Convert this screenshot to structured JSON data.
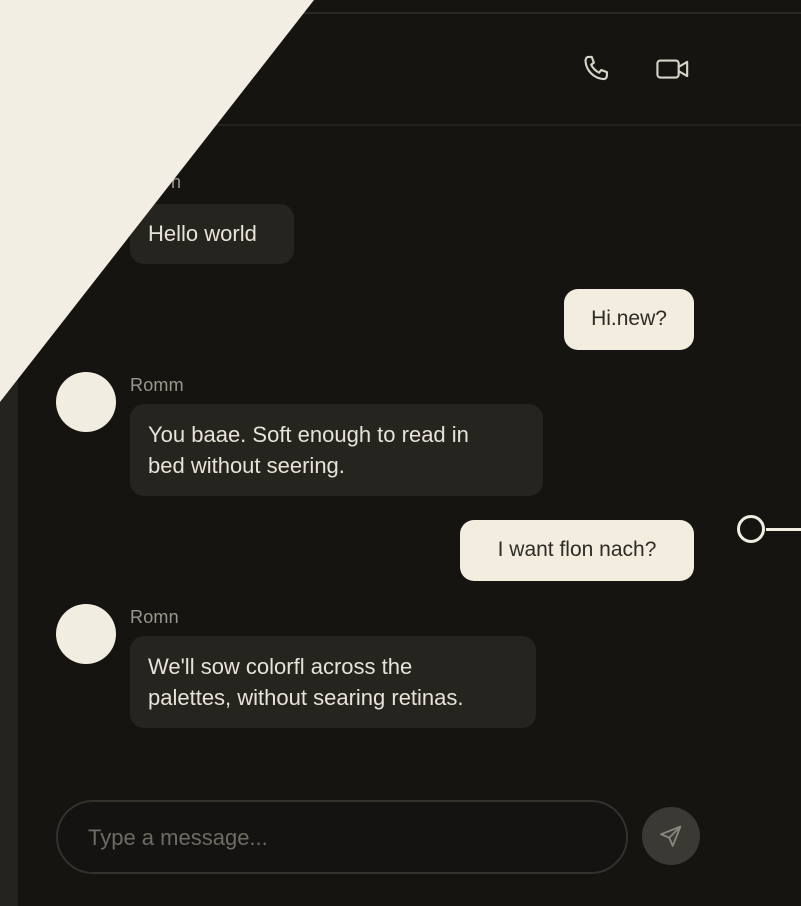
{
  "header": {
    "call_icon": "phone-icon",
    "video_icon": "video-camera-icon"
  },
  "messages": [
    {
      "direction": "incoming",
      "sender": "n",
      "text": "Hello world"
    },
    {
      "direction": "outgoing",
      "text": "Hi.new?"
    },
    {
      "direction": "incoming",
      "sender": "Romm",
      "lines": [
        "You baae. Soft enough to read in",
        "bed without seering."
      ]
    },
    {
      "direction": "outgoing",
      "text": "I want flon nach?"
    },
    {
      "direction": "incoming",
      "sender": "Romn",
      "lines": [
        "We'll sow colorfl across the",
        "palettes, without searing retinas."
      ]
    }
  ],
  "composer": {
    "placeholder": "Type a message...",
    "send_icon": "send-icon"
  },
  "colors": {
    "background": "#161411",
    "accent_cream": "#f2ede1",
    "bubble_incoming": "#26241f"
  }
}
